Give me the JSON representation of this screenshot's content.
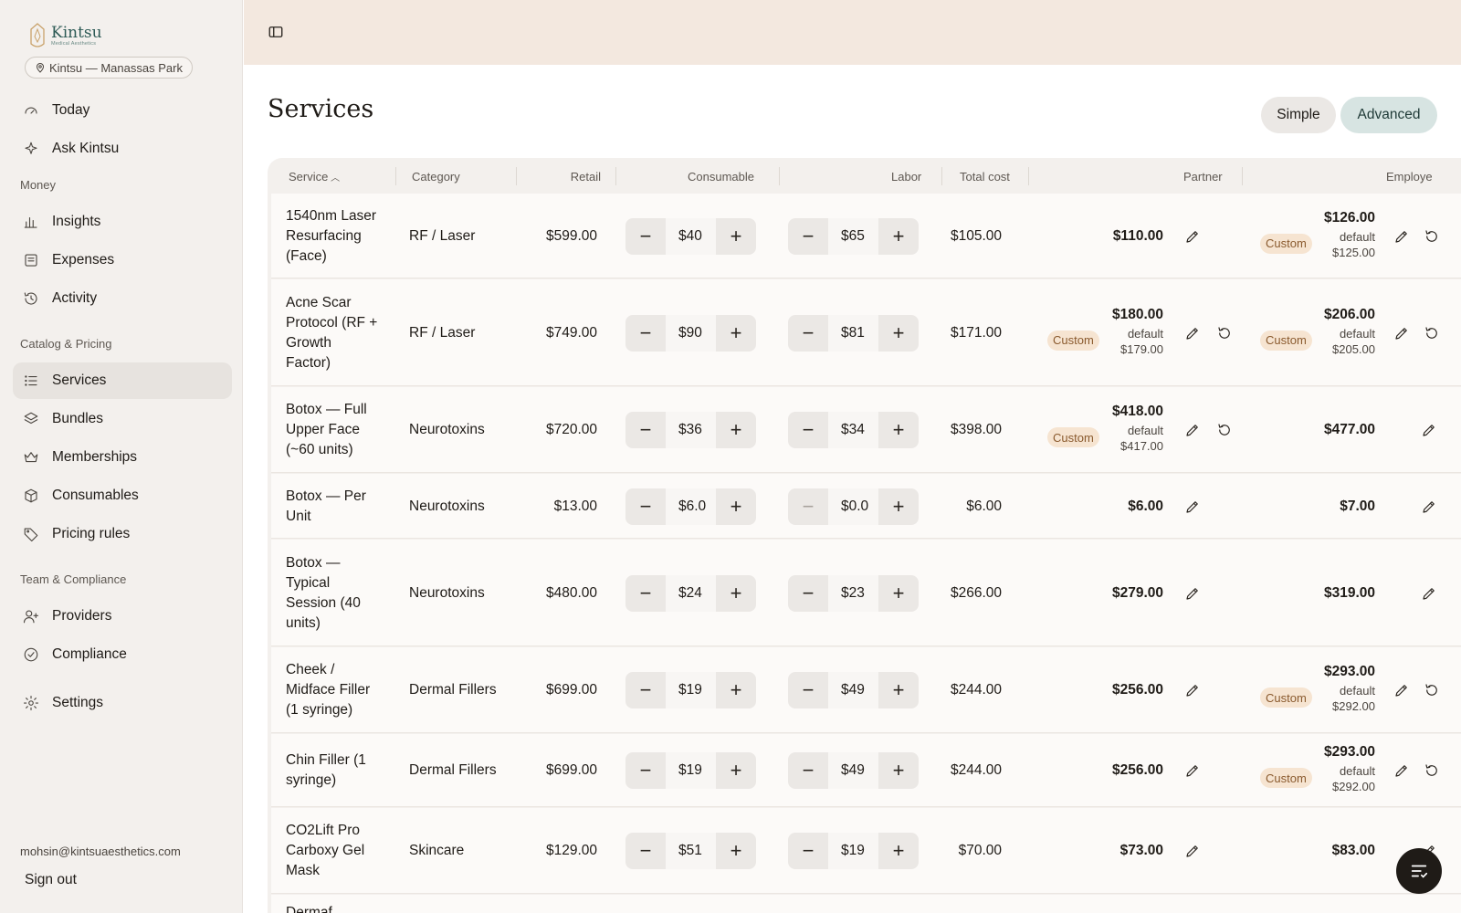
{
  "sidebar": {
    "logo": {
      "name": "Kintsu",
      "sub": "Medical Aesthetics"
    },
    "location": "Kintsu — Manassas Park",
    "top_items": [
      {
        "label": "Today",
        "icon": "gauge-icon"
      },
      {
        "label": "Ask Kintsu",
        "icon": "sparkle-icon"
      }
    ],
    "sections": [
      {
        "title": "Money",
        "items": [
          {
            "label": "Insights",
            "icon": "bar-chart-icon"
          },
          {
            "label": "Expenses",
            "icon": "receipt-icon"
          },
          {
            "label": "Activity",
            "icon": "history-icon"
          }
        ]
      },
      {
        "title": "Catalog & Pricing",
        "items": [
          {
            "label": "Services",
            "icon": "list-icon",
            "active": true
          },
          {
            "label": "Bundles",
            "icon": "layers-icon"
          },
          {
            "label": "Memberships",
            "icon": "crown-icon"
          },
          {
            "label": "Consumables",
            "icon": "box-icon"
          },
          {
            "label": "Pricing rules",
            "icon": "tag-icon"
          }
        ]
      },
      {
        "title": "Team & Compliance",
        "items": [
          {
            "label": "Providers",
            "icon": "user-plus-icon"
          },
          {
            "label": "Compliance",
            "icon": "check-badge-icon"
          }
        ]
      }
    ],
    "settings": "Settings",
    "user_email": "mohsin@kintsuaesthetics.com",
    "sign_out": "Sign out"
  },
  "page": {
    "title": "Services",
    "view_toggle": {
      "simple": "Simple",
      "advanced": "Advanced",
      "selected": "Advanced"
    }
  },
  "table": {
    "columns": [
      "Service",
      "Category",
      "Retail",
      "Consumable",
      "Labor",
      "Total cost",
      "Partner",
      "Employe"
    ],
    "sort_column": "Service",
    "rows": [
      {
        "service": [
          "1540nm Laser",
          "Resurfacing",
          "(Face)"
        ],
        "category": "RF / Laser",
        "retail": "$599.00",
        "consumable": "$40",
        "labor": "$65",
        "total": "$105.00",
        "partner": {
          "price": "$110.00"
        },
        "employee": {
          "price": "$126.00",
          "custom": "Custom",
          "default_label": "default",
          "default": "$125.00"
        }
      },
      {
        "service": [
          "Acne Scar",
          "Protocol (RF +",
          "Growth",
          "Factor)"
        ],
        "category": "RF / Laser",
        "retail": "$749.00",
        "consumable": "$90",
        "labor": "$81",
        "total": "$171.00",
        "partner": {
          "price": "$180.00",
          "custom": "Custom",
          "default_label": "default",
          "default": "$179.00"
        },
        "employee": {
          "price": "$206.00",
          "custom": "Custom",
          "default_label": "default",
          "default": "$205.00"
        }
      },
      {
        "service": [
          "Botox — Full",
          "Upper Face",
          "(~60 units)"
        ],
        "category": "Neurotoxins",
        "retail": "$720.00",
        "consumable": "$36",
        "labor": "$34",
        "total": "$398.00",
        "partner": {
          "price": "$418.00",
          "custom": "Custom",
          "default_label": "default",
          "default": "$417.00"
        },
        "employee": {
          "price": "$477.00"
        }
      },
      {
        "service": [
          "Botox — Per",
          "Unit"
        ],
        "category": "Neurotoxins",
        "retail": "$13.00",
        "consumable": "$6.0",
        "labor": "$0.0",
        "labor_minus_disabled": true,
        "total": "$6.00",
        "partner": {
          "price": "$6.00"
        },
        "employee": {
          "price": "$7.00"
        }
      },
      {
        "service": [
          "Botox —",
          "Typical",
          "Session (40",
          "units)"
        ],
        "category": "Neurotoxins",
        "retail": "$480.00",
        "consumable": "$24",
        "labor": "$23",
        "total": "$266.00",
        "partner": {
          "price": "$279.00"
        },
        "employee": {
          "price": "$319.00"
        }
      },
      {
        "service": [
          "Cheek /",
          "Midface Filler",
          "(1 syringe)"
        ],
        "category": "Dermal Fillers",
        "retail": "$699.00",
        "consumable": "$19",
        "labor": "$49",
        "total": "$244.00",
        "partner": {
          "price": "$256.00"
        },
        "employee": {
          "price": "$293.00",
          "custom": "Custom",
          "default_label": "default",
          "default": "$292.00"
        }
      },
      {
        "service": [
          "Chin Filler (1",
          "syringe)"
        ],
        "category": "Dermal Fillers",
        "retail": "$699.00",
        "consumable": "$19",
        "labor": "$49",
        "total": "$244.00",
        "partner": {
          "price": "$256.00"
        },
        "employee": {
          "price": "$293.00",
          "custom": "Custom",
          "default_label": "default",
          "default": "$292.00"
        }
      },
      {
        "service": [
          "CO2Lift Pro",
          "Carboxy Gel",
          "Mask"
        ],
        "category": "Skincare",
        "retail": "$129.00",
        "consumable": "$51",
        "labor": "$19",
        "total": "$70.00",
        "partner": {
          "price": "$73.00"
        },
        "employee": {
          "price": "$83.00"
        }
      },
      {
        "service": [
          "Dermaf"
        ],
        "category": "",
        "retail": "",
        "consumable": "",
        "labor": "",
        "total": "",
        "partner": {},
        "employee": {}
      }
    ]
  },
  "colors": {
    "accent": "#d7e4e2",
    "topbar": "#f3e8df",
    "badge_bg": "#f6e4d1",
    "badge_text": "#8a5a2e"
  }
}
